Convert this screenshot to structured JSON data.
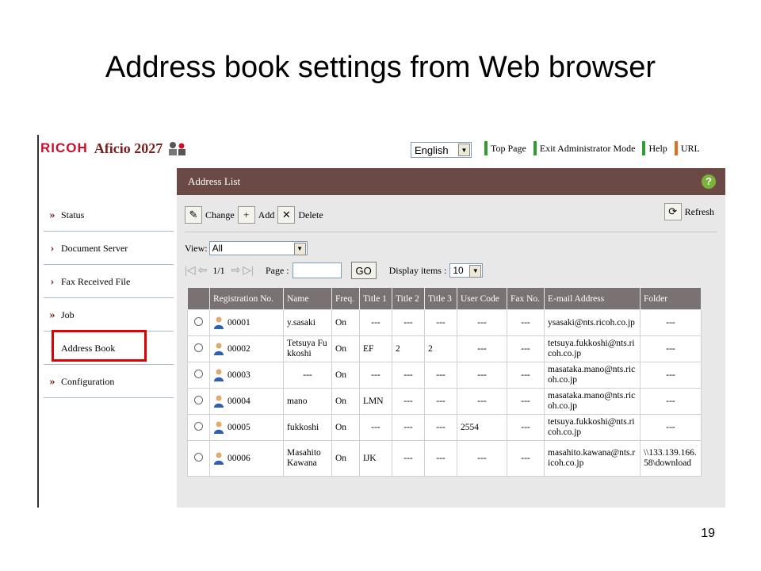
{
  "slide": {
    "title": "Address book settings from Web browser",
    "page_number": "19"
  },
  "header": {
    "logo": "RICOH",
    "product": "Aficio 2027",
    "language": "English",
    "links": [
      {
        "label": "Top Page",
        "color": "#2e9e2e"
      },
      {
        "label": "Exit Administrator Mode",
        "color": "#2e9e2e"
      },
      {
        "label": "Help",
        "color": "#2e9e2e"
      },
      {
        "label": "URL",
        "color": "#e07020"
      }
    ]
  },
  "sidebar": {
    "items": [
      {
        "label": "Status",
        "icon": "double-chevron"
      },
      {
        "label": "Document Server",
        "icon": "chevron"
      },
      {
        "label": "Fax Received File",
        "icon": "chevron"
      },
      {
        "label": "Job",
        "icon": "double-chevron"
      },
      {
        "label": "Address Book",
        "icon": "chevron"
      },
      {
        "label": "Configuration",
        "icon": "double-chevron"
      }
    ],
    "highlighted": "Address Book"
  },
  "content": {
    "header_title": "Address List",
    "help_icon": "?",
    "toolbar": {
      "change": "Change",
      "add": "Add",
      "delete": "Delete",
      "refresh": "Refresh"
    },
    "view_label": "View:",
    "view_value": "All",
    "page_indicator": "1/1",
    "page_label": "Page :",
    "go_label": "GO",
    "display_items_label": "Display items :",
    "display_items_value": "10"
  },
  "table": {
    "columns": [
      "Registration No.",
      "Name",
      "Freq.",
      "Title 1",
      "Title 2",
      "Title 3",
      "User Code",
      "Fax No.",
      "E-mail Address",
      "Folder"
    ],
    "rows": [
      [
        "00001",
        "y.sasaki",
        "On",
        "---",
        "---",
        "---",
        "---",
        "---",
        "ysasaki@nts.ricoh.co.jp",
        "---"
      ],
      [
        "00002",
        "Tetsuya Fukkoshi",
        "On",
        "EF",
        "2",
        "2",
        "---",
        "---",
        "tetsuya.fukkoshi@nts.ricoh.co.jp",
        "---"
      ],
      [
        "00003",
        "---",
        "On",
        "---",
        "---",
        "---",
        "---",
        "---",
        "masataka.mano@nts.ricoh.co.jp",
        "---"
      ],
      [
        "00004",
        "mano",
        "On",
        "LMN",
        "---",
        "---",
        "---",
        "---",
        "masataka.mano@nts.ricoh.co.jp",
        "---"
      ],
      [
        "00005",
        "fukkoshi",
        "On",
        "---",
        "---",
        "---",
        "2554",
        "---",
        "tetsuya.fukkoshi@nts.ricoh.co.jp",
        "---"
      ],
      [
        "00006",
        "Masahito Kawana",
        "On",
        "IJK",
        "---",
        "---",
        "---",
        "---",
        "masahito.kawana@nts.ricoh.co.jp",
        "\\\\133.139.166.58\\download"
      ]
    ]
  }
}
